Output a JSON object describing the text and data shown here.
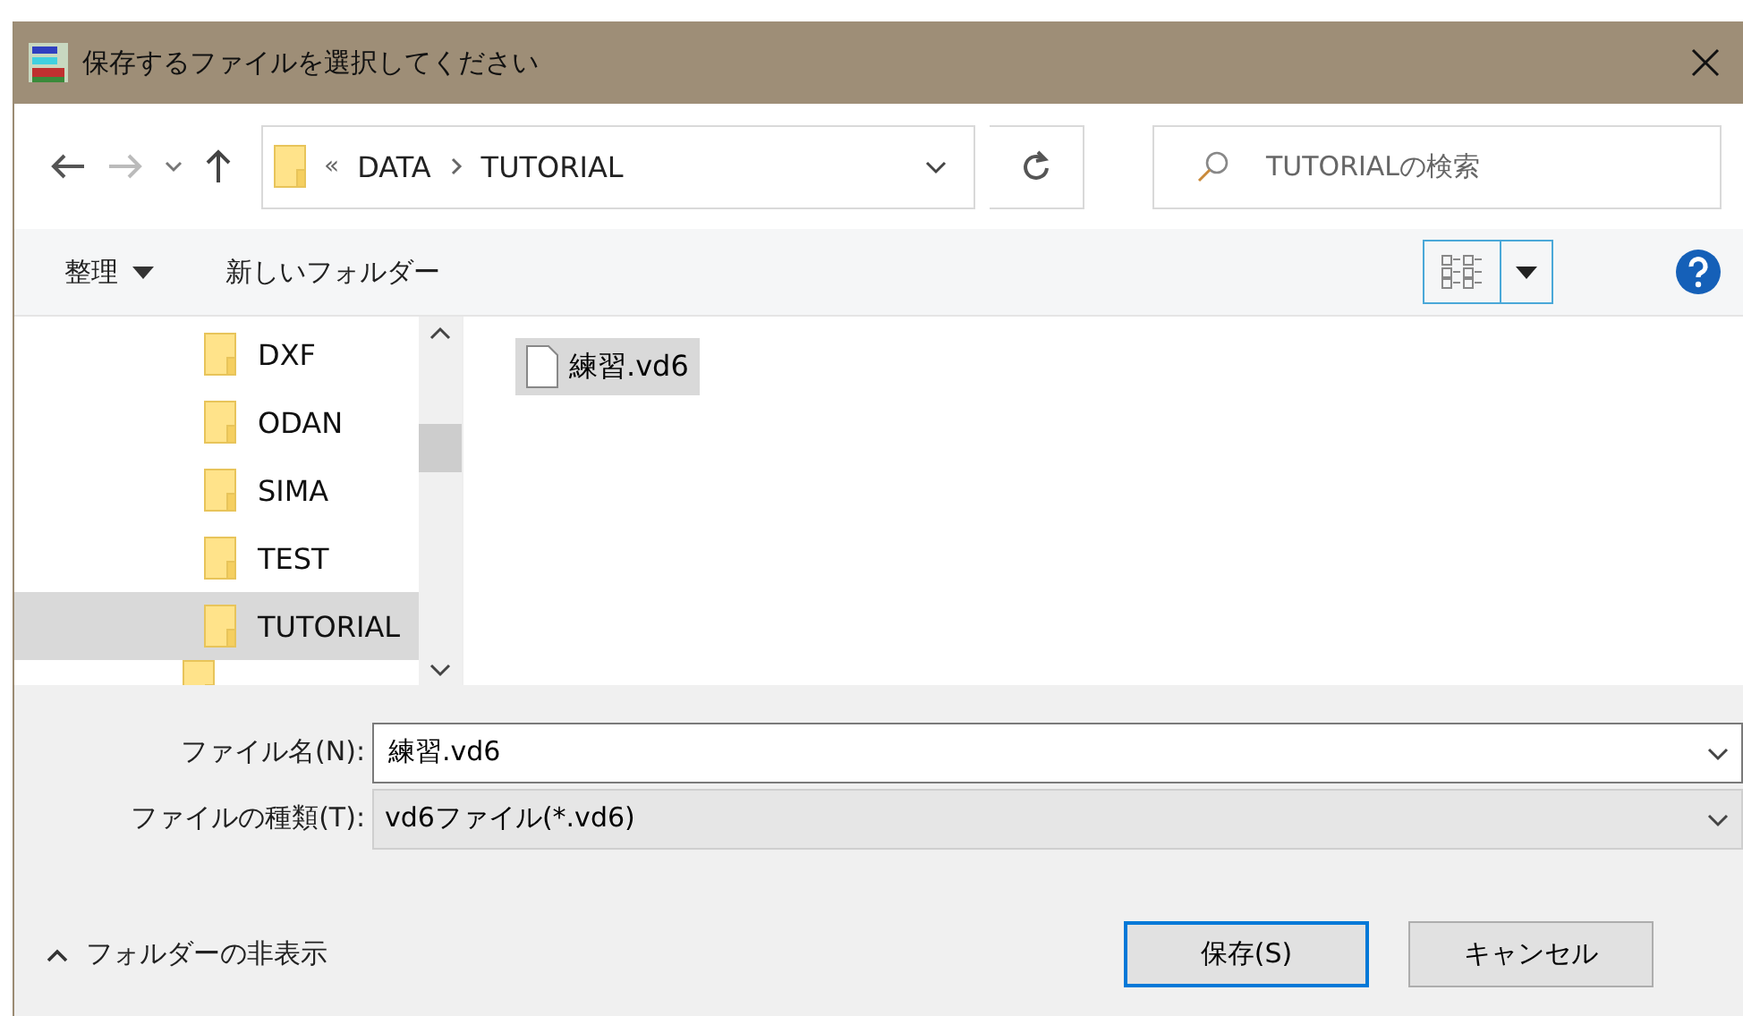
{
  "window": {
    "title": "保存するファイルを選択してください"
  },
  "navigation": {
    "path": [
      {
        "label": "DATA"
      },
      {
        "label": "TUTORIAL"
      }
    ],
    "overflow": "«",
    "search": {
      "placeholder": "TUTORIALの検索"
    }
  },
  "toolbar": {
    "organize": "整理",
    "new_folder": "新しいフォルダー"
  },
  "tree": {
    "items": [
      {
        "label": "DXF",
        "selected": false
      },
      {
        "label": "ODAN",
        "selected": false
      },
      {
        "label": "SIMA",
        "selected": false
      },
      {
        "label": "TEST",
        "selected": false
      },
      {
        "label": "TUTORIAL",
        "selected": true
      }
    ]
  },
  "files": [
    {
      "name": "練習.vd6",
      "selected": true
    }
  ],
  "form": {
    "filename": {
      "label": "ファイル名(N):",
      "value": "練習.vd6"
    },
    "filetype": {
      "label": "ファイルの種類(T):",
      "value": "vd6ファイル(*.vd6)"
    }
  },
  "hide_folders": "フォルダーの非表示",
  "buttons": [
    {
      "label": "保存(S)",
      "default": true
    },
    {
      "label": "キャンセル",
      "default": false
    }
  ]
}
